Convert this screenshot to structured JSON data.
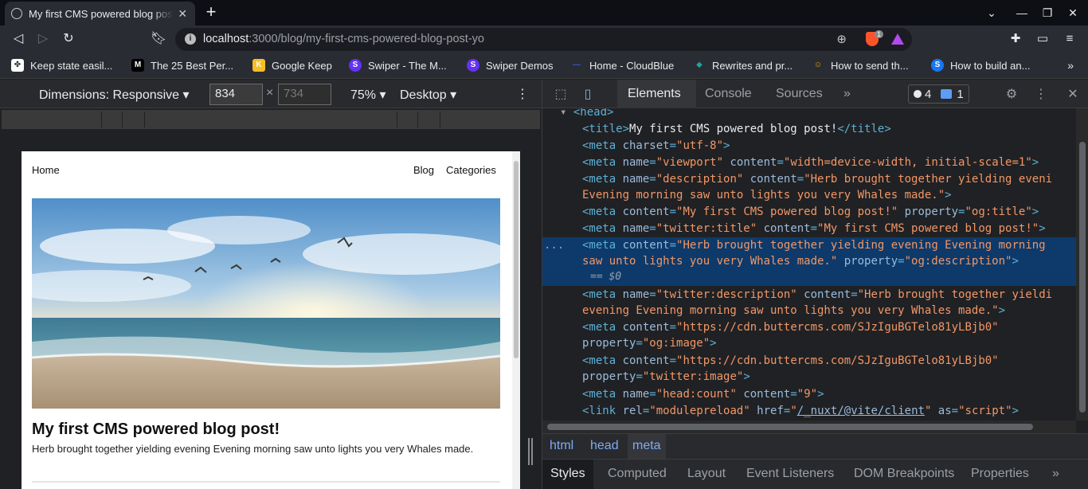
{
  "browser": {
    "tab_title": "My first CMS powered blog post!",
    "url_host": "localhost",
    "url_path": ":3000/blog/my-first-cms-powered-blog-post-yo",
    "shield_count": "1"
  },
  "bookmarks": [
    {
      "label": "Keep state easil...",
      "color": "#ffffff",
      "glyph": "✤"
    },
    {
      "label": "The 25 Best Per...",
      "color": "#000000",
      "glyph": "M"
    },
    {
      "label": "Google Keep",
      "color": "#f6bf26",
      "glyph": "K"
    },
    {
      "label": "Swiper - The M...",
      "color": "#6332f6",
      "glyph": "S"
    },
    {
      "label": "Swiper Demos",
      "color": "#6332f6",
      "glyph": "S"
    },
    {
      "label": "Home - CloudBlue",
      "color": "#2a5bd7",
      "glyph": "—"
    },
    {
      "label": "Rewrites and pr...",
      "color": "#1fa2a2",
      "glyph": "◆"
    },
    {
      "label": "How to send th...",
      "color": "#e0a600",
      "glyph": "☺"
    },
    {
      "label": "How to build an...",
      "color": "#1877f2",
      "glyph": "S"
    }
  ],
  "device_toolbar": {
    "dimensions_label": "Dimensions: Responsive",
    "width": "834",
    "height": "734",
    "times": "×",
    "zoom": "75%",
    "mode": "Desktop"
  },
  "page": {
    "nav_home": "Home",
    "nav_blog": "Blog",
    "nav_categories": "Categories",
    "title": "My first CMS powered blog post!",
    "description": "Herb brought together yielding evening Evening morning saw unto lights you very Whales made."
  },
  "devtools": {
    "tabs": [
      "Elements",
      "Console",
      "Sources"
    ],
    "more": "»",
    "warn_count": "4",
    "msg_count": "1",
    "breadcrumbs": [
      "html",
      "head",
      "meta"
    ],
    "subtabs": [
      "Styles",
      "Computed",
      "Layout",
      "Event Listeners",
      "DOM Breakpoints",
      "Properties"
    ],
    "dollar_hint": "== $0",
    "ellipsis": "..."
  },
  "code_lines": [
    {
      "indent": "  ",
      "tag_open": "<head>",
      "partial": true
    },
    {
      "text": "<title>My first CMS powered blog post!</title>"
    },
    {
      "text": "<meta charset=\"utf-8\">"
    },
    {
      "text": "<meta name=\"viewport\" content=\"width=device-width, initial-scale=1\">"
    },
    {
      "text": "<meta name=\"description\" content=\"Herb brought together yielding eveni"
    },
    {
      "text": "Evening morning saw unto lights you very Whales made.\">"
    },
    {
      "text": "<meta content=\"My first CMS powered blog post!\" property=\"og:title\">"
    },
    {
      "text": "<meta name=\"twitter:title\" content=\"My first CMS powered blog post!\">"
    },
    {
      "text": "<meta content=\"Herb brought together yielding evening Evening morning"
    },
    {
      "text": "saw unto lights you very Whales made.\" property=\"og:description\">"
    },
    {
      "text": "== $0"
    },
    {
      "text": "<meta name=\"twitter:description\" content=\"Herb brought together yieldi"
    },
    {
      "text": "evening Evening morning saw unto lights you very Whales made.\">"
    },
    {
      "text": "<meta content=\"https://cdn.buttercms.com/SJzIguBGTelo81yLBjb0\""
    },
    {
      "text": "property=\"og:image\">"
    },
    {
      "text": "<meta content=\"https://cdn.buttercms.com/SJzIguBGTelo81yLBjb0\""
    },
    {
      "text": "property=\"twitter:image\">"
    },
    {
      "text": "<meta name=\"head:count\" content=\"9\">"
    },
    {
      "text": "<link rel=\"modulepreload\" href=\"/_nuxt/@vite/client\" as=\"script\">"
    }
  ]
}
